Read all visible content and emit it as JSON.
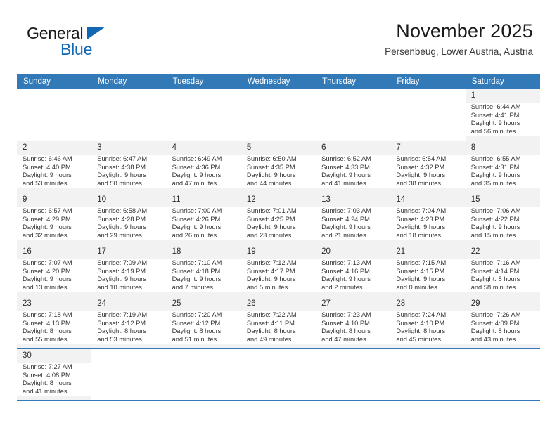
{
  "brand": {
    "name_part1": "General",
    "name_part2": "Blue",
    "triangle_color": "#1268b3"
  },
  "header": {
    "title": "November 2025",
    "subtitle": "Persenbeug, Lower Austria, Austria"
  },
  "theme": {
    "header_bg": "#3279b7",
    "shade_bg": "#f2f2f2",
    "row_border": "#3279b7"
  },
  "calendar": {
    "weekday_headers": [
      "Sunday",
      "Monday",
      "Tuesday",
      "Wednesday",
      "Thursday",
      "Friday",
      "Saturday"
    ],
    "weeks": [
      [
        {
          "day": "",
          "lines": [],
          "empty": true
        },
        {
          "day": "",
          "lines": [],
          "empty": true
        },
        {
          "day": "",
          "lines": [],
          "empty": true
        },
        {
          "day": "",
          "lines": [],
          "empty": true
        },
        {
          "day": "",
          "lines": [],
          "empty": true
        },
        {
          "day": "",
          "lines": [],
          "empty": true
        },
        {
          "day": "1",
          "lines": [
            "Sunrise: 6:44 AM",
            "Sunset: 4:41 PM",
            "Daylight: 9 hours",
            "and 56 minutes."
          ],
          "empty": false
        }
      ],
      [
        {
          "day": "2",
          "lines": [
            "Sunrise: 6:46 AM",
            "Sunset: 4:40 PM",
            "Daylight: 9 hours",
            "and 53 minutes."
          ],
          "empty": false
        },
        {
          "day": "3",
          "lines": [
            "Sunrise: 6:47 AM",
            "Sunset: 4:38 PM",
            "Daylight: 9 hours",
            "and 50 minutes."
          ],
          "empty": false
        },
        {
          "day": "4",
          "lines": [
            "Sunrise: 6:49 AM",
            "Sunset: 4:36 PM",
            "Daylight: 9 hours",
            "and 47 minutes."
          ],
          "empty": false
        },
        {
          "day": "5",
          "lines": [
            "Sunrise: 6:50 AM",
            "Sunset: 4:35 PM",
            "Daylight: 9 hours",
            "and 44 minutes."
          ],
          "empty": false
        },
        {
          "day": "6",
          "lines": [
            "Sunrise: 6:52 AM",
            "Sunset: 4:33 PM",
            "Daylight: 9 hours",
            "and 41 minutes."
          ],
          "empty": false
        },
        {
          "day": "7",
          "lines": [
            "Sunrise: 6:54 AM",
            "Sunset: 4:32 PM",
            "Daylight: 9 hours",
            "and 38 minutes."
          ],
          "empty": false
        },
        {
          "day": "8",
          "lines": [
            "Sunrise: 6:55 AM",
            "Sunset: 4:31 PM",
            "Daylight: 9 hours",
            "and 35 minutes."
          ],
          "empty": false
        }
      ],
      [
        {
          "day": "9",
          "lines": [
            "Sunrise: 6:57 AM",
            "Sunset: 4:29 PM",
            "Daylight: 9 hours",
            "and 32 minutes."
          ],
          "empty": false
        },
        {
          "day": "10",
          "lines": [
            "Sunrise: 6:58 AM",
            "Sunset: 4:28 PM",
            "Daylight: 9 hours",
            "and 29 minutes."
          ],
          "empty": false
        },
        {
          "day": "11",
          "lines": [
            "Sunrise: 7:00 AM",
            "Sunset: 4:26 PM",
            "Daylight: 9 hours",
            "and 26 minutes."
          ],
          "empty": false
        },
        {
          "day": "12",
          "lines": [
            "Sunrise: 7:01 AM",
            "Sunset: 4:25 PM",
            "Daylight: 9 hours",
            "and 23 minutes."
          ],
          "empty": false
        },
        {
          "day": "13",
          "lines": [
            "Sunrise: 7:03 AM",
            "Sunset: 4:24 PM",
            "Daylight: 9 hours",
            "and 21 minutes."
          ],
          "empty": false
        },
        {
          "day": "14",
          "lines": [
            "Sunrise: 7:04 AM",
            "Sunset: 4:23 PM",
            "Daylight: 9 hours",
            "and 18 minutes."
          ],
          "empty": false
        },
        {
          "day": "15",
          "lines": [
            "Sunrise: 7:06 AM",
            "Sunset: 4:22 PM",
            "Daylight: 9 hours",
            "and 15 minutes."
          ],
          "empty": false
        }
      ],
      [
        {
          "day": "16",
          "lines": [
            "Sunrise: 7:07 AM",
            "Sunset: 4:20 PM",
            "Daylight: 9 hours",
            "and 13 minutes."
          ],
          "empty": false
        },
        {
          "day": "17",
          "lines": [
            "Sunrise: 7:09 AM",
            "Sunset: 4:19 PM",
            "Daylight: 9 hours",
            "and 10 minutes."
          ],
          "empty": false
        },
        {
          "day": "18",
          "lines": [
            "Sunrise: 7:10 AM",
            "Sunset: 4:18 PM",
            "Daylight: 9 hours",
            "and 7 minutes."
          ],
          "empty": false
        },
        {
          "day": "19",
          "lines": [
            "Sunrise: 7:12 AM",
            "Sunset: 4:17 PM",
            "Daylight: 9 hours",
            "and 5 minutes."
          ],
          "empty": false
        },
        {
          "day": "20",
          "lines": [
            "Sunrise: 7:13 AM",
            "Sunset: 4:16 PM",
            "Daylight: 9 hours",
            "and 2 minutes."
          ],
          "empty": false
        },
        {
          "day": "21",
          "lines": [
            "Sunrise: 7:15 AM",
            "Sunset: 4:15 PM",
            "Daylight: 9 hours",
            "and 0 minutes."
          ],
          "empty": false
        },
        {
          "day": "22",
          "lines": [
            "Sunrise: 7:16 AM",
            "Sunset: 4:14 PM",
            "Daylight: 8 hours",
            "and 58 minutes."
          ],
          "empty": false
        }
      ],
      [
        {
          "day": "23",
          "lines": [
            "Sunrise: 7:18 AM",
            "Sunset: 4:13 PM",
            "Daylight: 8 hours",
            "and 55 minutes."
          ],
          "empty": false
        },
        {
          "day": "24",
          "lines": [
            "Sunrise: 7:19 AM",
            "Sunset: 4:12 PM",
            "Daylight: 8 hours",
            "and 53 minutes."
          ],
          "empty": false
        },
        {
          "day": "25",
          "lines": [
            "Sunrise: 7:20 AM",
            "Sunset: 4:12 PM",
            "Daylight: 8 hours",
            "and 51 minutes."
          ],
          "empty": false
        },
        {
          "day": "26",
          "lines": [
            "Sunrise: 7:22 AM",
            "Sunset: 4:11 PM",
            "Daylight: 8 hours",
            "and 49 minutes."
          ],
          "empty": false
        },
        {
          "day": "27",
          "lines": [
            "Sunrise: 7:23 AM",
            "Sunset: 4:10 PM",
            "Daylight: 8 hours",
            "and 47 minutes."
          ],
          "empty": false
        },
        {
          "day": "28",
          "lines": [
            "Sunrise: 7:24 AM",
            "Sunset: 4:10 PM",
            "Daylight: 8 hours",
            "and 45 minutes."
          ],
          "empty": false
        },
        {
          "day": "29",
          "lines": [
            "Sunrise: 7:26 AM",
            "Sunset: 4:09 PM",
            "Daylight: 8 hours",
            "and 43 minutes."
          ],
          "empty": false
        }
      ],
      [
        {
          "day": "30",
          "lines": [
            "Sunrise: 7:27 AM",
            "Sunset: 4:08 PM",
            "Daylight: 8 hours",
            "and 41 minutes."
          ],
          "empty": false
        },
        {
          "day": "",
          "lines": [],
          "empty": true
        },
        {
          "day": "",
          "lines": [],
          "empty": true
        },
        {
          "day": "",
          "lines": [],
          "empty": true
        },
        {
          "day": "",
          "lines": [],
          "empty": true
        },
        {
          "day": "",
          "lines": [],
          "empty": true
        },
        {
          "day": "",
          "lines": [],
          "empty": true
        }
      ]
    ]
  }
}
